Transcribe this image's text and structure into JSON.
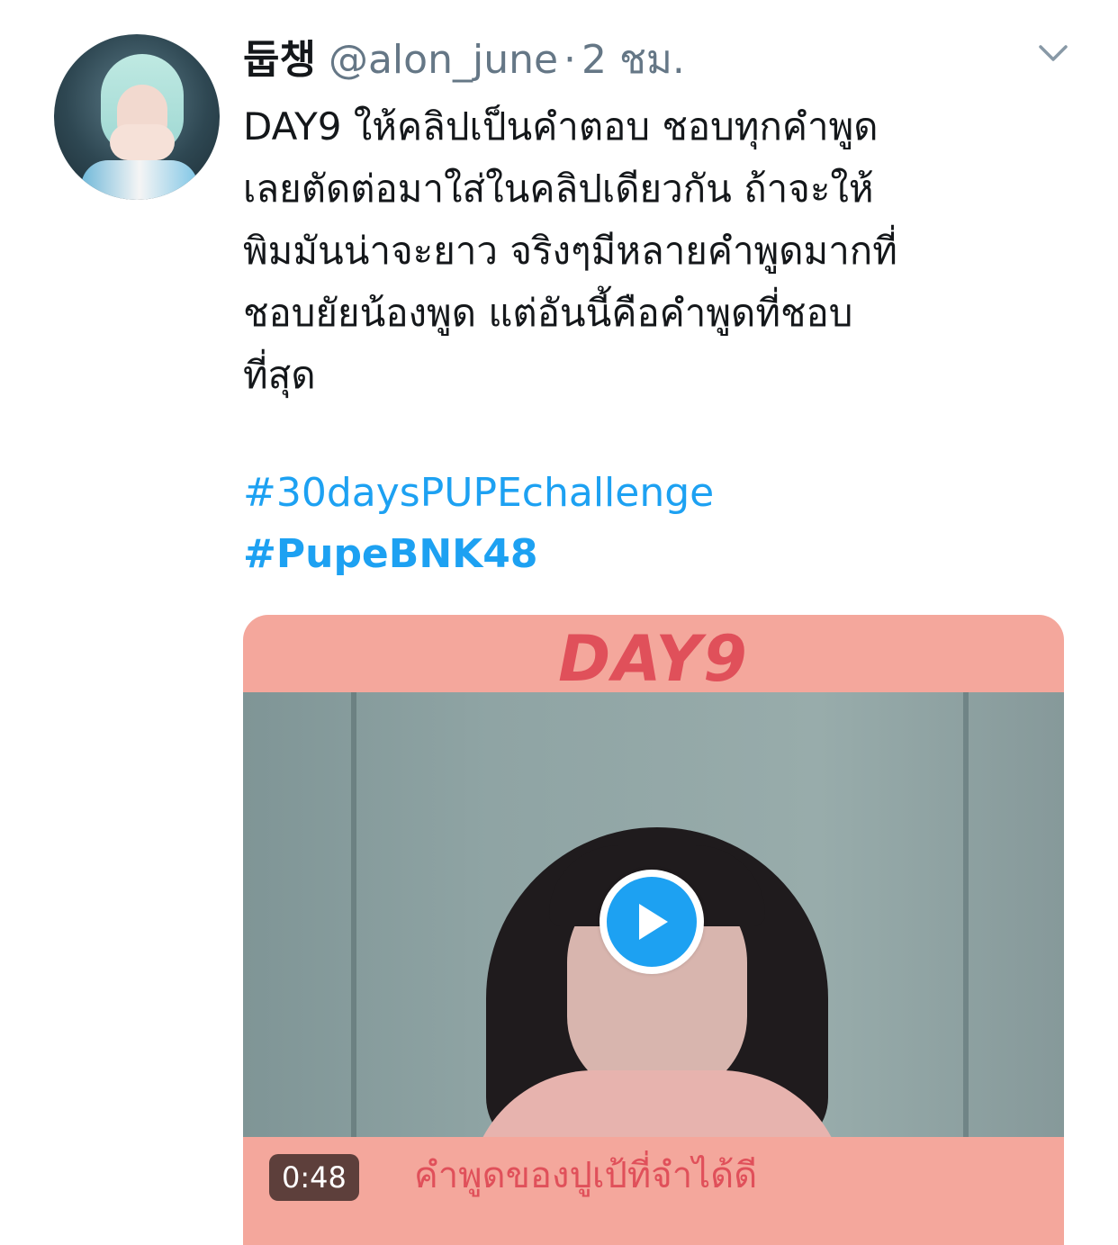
{
  "tweet": {
    "display_name": "둡챙",
    "handle": "@alon_june",
    "separator": "·",
    "time": "2 ชม.",
    "text_lines": [
      "DAY9 ให้คลิปเป็นคำตอบ ชอบทุกคำพูด",
      "เลยตัดต่อมาใส่ในคลิปเดียวกัน ถ้าจะให้",
      "พิมมันน่าจะยาว จริงๆมีหลายคำพูดมากที่",
      "ชอบยัยน้องพูด แต่อันนี้คือคำพูดที่ชอบ",
      "ที่สุด"
    ],
    "hashtags": [
      "#30daysPUPEchallenge",
      "#PupeBNK48"
    ]
  },
  "media": {
    "banner_text": "DAY9",
    "caption_text": "คำพูดของปูเป้ที่จำได้ดี",
    "duration": "0:48"
  },
  "icons": {
    "caret": "chevron-down-icon",
    "play": "play-icon"
  },
  "colors": {
    "link": "#1da1f2",
    "muted": "#657786",
    "text": "#14171a",
    "media_banner": "#f4a79c",
    "banner_text": "#e0505a"
  }
}
